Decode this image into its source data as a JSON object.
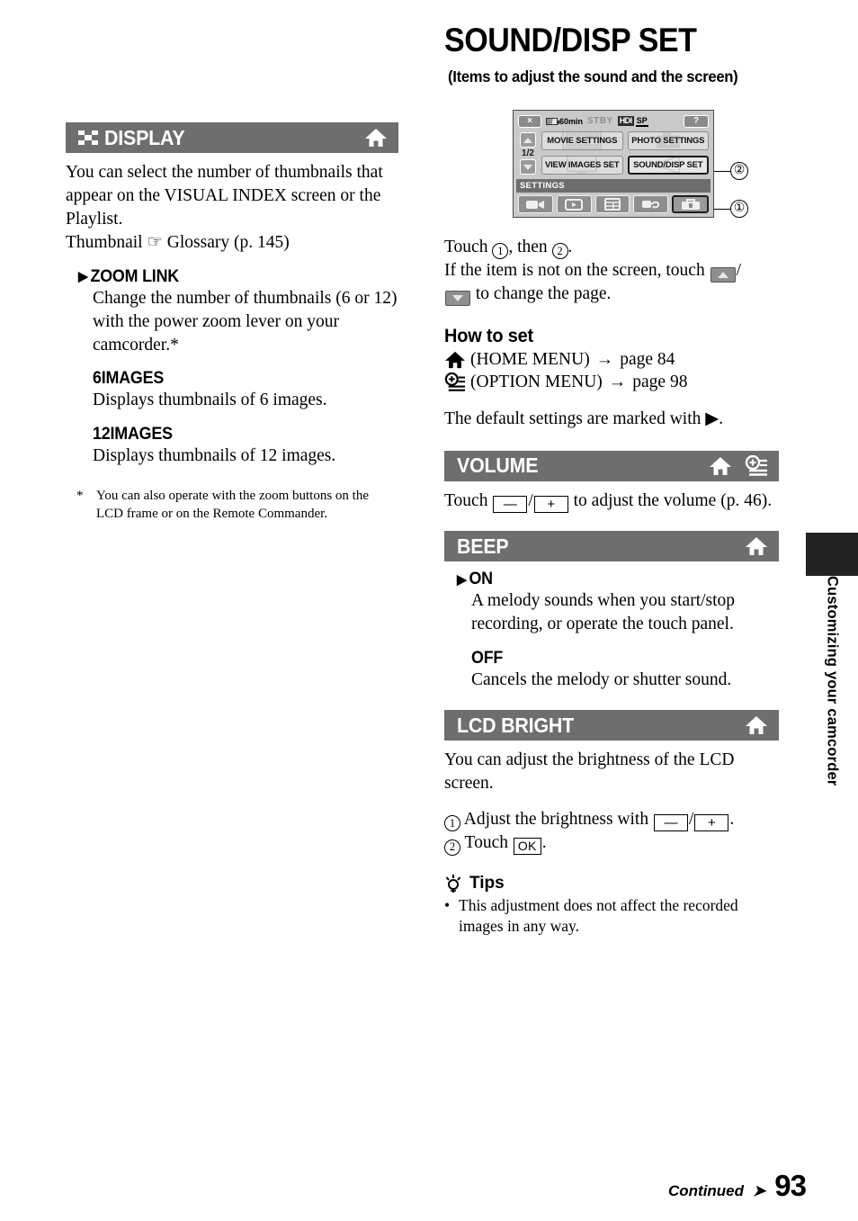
{
  "page": {
    "title": "SOUND/DISP SET",
    "subtitle": "(Items to adjust the sound and the screen)",
    "number": "93",
    "continued": "Continued",
    "side_tab": "Customizing your camcorder"
  },
  "left_column": {
    "section": {
      "icon": "checkerboard-icon",
      "title": "DISPLAY",
      "icons": [
        "home-icon"
      ]
    },
    "intro": "You can select the number of thumbnails that appear on the VISUAL INDEX screen or the Playlist.",
    "thumbnail_ref": "Thumbnail ☞ Glossary (p. 145)",
    "options": [
      {
        "label": "ZOOM LINK",
        "is_default": true,
        "description": "Change the number of thumbnails (6 or 12) with the power zoom lever on your camcorder.*"
      },
      {
        "label": "6IMAGES",
        "is_default": false,
        "description": "Displays thumbnails of 6 images."
      },
      {
        "label": "12IMAGES",
        "is_default": false,
        "description": "Displays thumbnails of 12 images."
      }
    ],
    "footnote": {
      "marker": "*",
      "text": "You can also operate with the zoom buttons on the LCD frame or on the Remote Commander."
    }
  },
  "lcd_diagram": {
    "status_bar": {
      "close_button": "×",
      "battery_time": "60min",
      "mode": "STBY",
      "format_hd": "HDI",
      "format_quality": "SP",
      "help_button": "?"
    },
    "page_indicator": "1/2",
    "scroll_up": "up-arrow-button",
    "scroll_down": "down-arrow-button",
    "menu_items": [
      {
        "label": "MOVIE SETTINGS",
        "selected": false,
        "ghost": "film-strip"
      },
      {
        "label": "PHOTO SETTINGS",
        "selected": false,
        "ghost": "camera"
      },
      {
        "label": "VIEW IMAGES SET",
        "selected": false,
        "ghost": "tv"
      },
      {
        "label": "SOUND/DISP SET",
        "selected": true,
        "ghost": "speaker"
      }
    ],
    "category_label": "SETTINGS",
    "tabs": [
      {
        "name": "camera-tab",
        "selected": false
      },
      {
        "name": "playback-tab",
        "selected": false
      },
      {
        "name": "manage-media-tab",
        "selected": false
      },
      {
        "name": "others-tab",
        "selected": false
      },
      {
        "name": "settings-tab",
        "selected": true
      }
    ],
    "callouts": [
      {
        "number": "②"
      },
      {
        "number": "①"
      }
    ]
  },
  "instructions": {
    "line1_pre": "Touch ",
    "line1_num1": "①",
    "line1_mid": ", then ",
    "line1_num2": "②",
    "line1_post": ".",
    "line2_pre": "If the item is not on the screen, touch ",
    "line2_post": "/",
    "line3": " to change the page."
  },
  "how_to_set": {
    "heading": "How to set",
    "rows": [
      {
        "icon": "home-icon",
        "label": "(HOME MENU)",
        "arrow": "→",
        "page": "page 84"
      },
      {
        "icon": "option-menu-icon",
        "label": "(OPTION MENU)",
        "arrow": "→",
        "page": "page 98"
      }
    ],
    "default_note_pre": "The default settings are marked with ",
    "default_note_mark": "▶",
    "default_note_post": "."
  },
  "sections": [
    {
      "title": "VOLUME",
      "icons": [
        "home-icon",
        "option-menu-icon"
      ],
      "body_pre": "Touch ",
      "minus": "—",
      "slash": "/",
      "plus": "+",
      "body_post": " to adjust the volume (p. 46)."
    },
    {
      "title": "BEEP",
      "icons": [
        "home-icon"
      ],
      "options": [
        {
          "label": "ON",
          "is_default": true,
          "description": "A melody sounds when you start/stop recording, or operate the touch panel."
        },
        {
          "label": "OFF",
          "is_default": false,
          "description": "Cancels the melody or shutter sound."
        }
      ]
    },
    {
      "title": "LCD BRIGHT",
      "icons": [
        "home-icon"
      ],
      "intro": "You can adjust the brightness of the LCD screen.",
      "steps": [
        {
          "num": "①",
          "pre": " Adjust the brightness with ",
          "minus": "—",
          "slash": "/",
          "plus": "+",
          "post": "."
        },
        {
          "num": "②",
          "pre": " Touch ",
          "key": "OK",
          "post": "."
        }
      ],
      "tips": {
        "heading": "Tips",
        "items": [
          "This adjustment does not affect the recorded images in any way."
        ]
      }
    }
  ],
  "colors": {
    "header_bar": "#6e6e6e",
    "lcd_body": "#c9c9c9",
    "lcd_header": "#6d6d6d",
    "side_tab": "#222222"
  }
}
